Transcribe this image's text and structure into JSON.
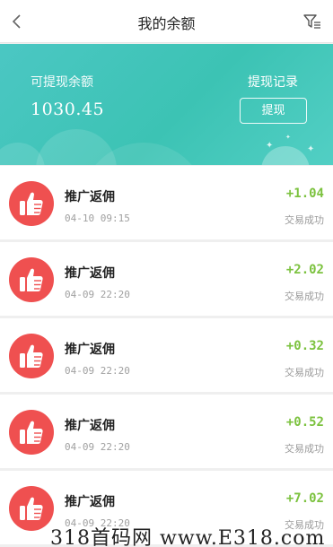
{
  "header": {
    "title": "我的余额",
    "back_icon": "chevron-left-icon",
    "filter_icon": "filter-icon"
  },
  "balance": {
    "label": "可提现余额",
    "amount": "1030.45",
    "record_label": "提现记录",
    "withdraw_button": "提现"
  },
  "transactions": [
    {
      "name": "推广返佣",
      "time": "04-10 09:15",
      "amount": "+1.04",
      "status": "交易成功"
    },
    {
      "name": "推广返佣",
      "time": "04-09 22:20",
      "amount": "+2.02",
      "status": "交易成功"
    },
    {
      "name": "推广返佣",
      "time": "04-09 22:20",
      "amount": "+0.32",
      "status": "交易成功"
    },
    {
      "name": "推广返佣",
      "time": "04-09 22:20",
      "amount": "+0.52",
      "status": "交易成功"
    },
    {
      "name": "推广返佣",
      "time": "04-09 22:20",
      "amount": "+7.02",
      "status": "交易成功"
    }
  ],
  "watermark": "318首码网 www.E318.com",
  "colors": {
    "banner": "#3cc3b4",
    "avatar": "#ef5050",
    "amount_positive": "#7cc23f"
  }
}
